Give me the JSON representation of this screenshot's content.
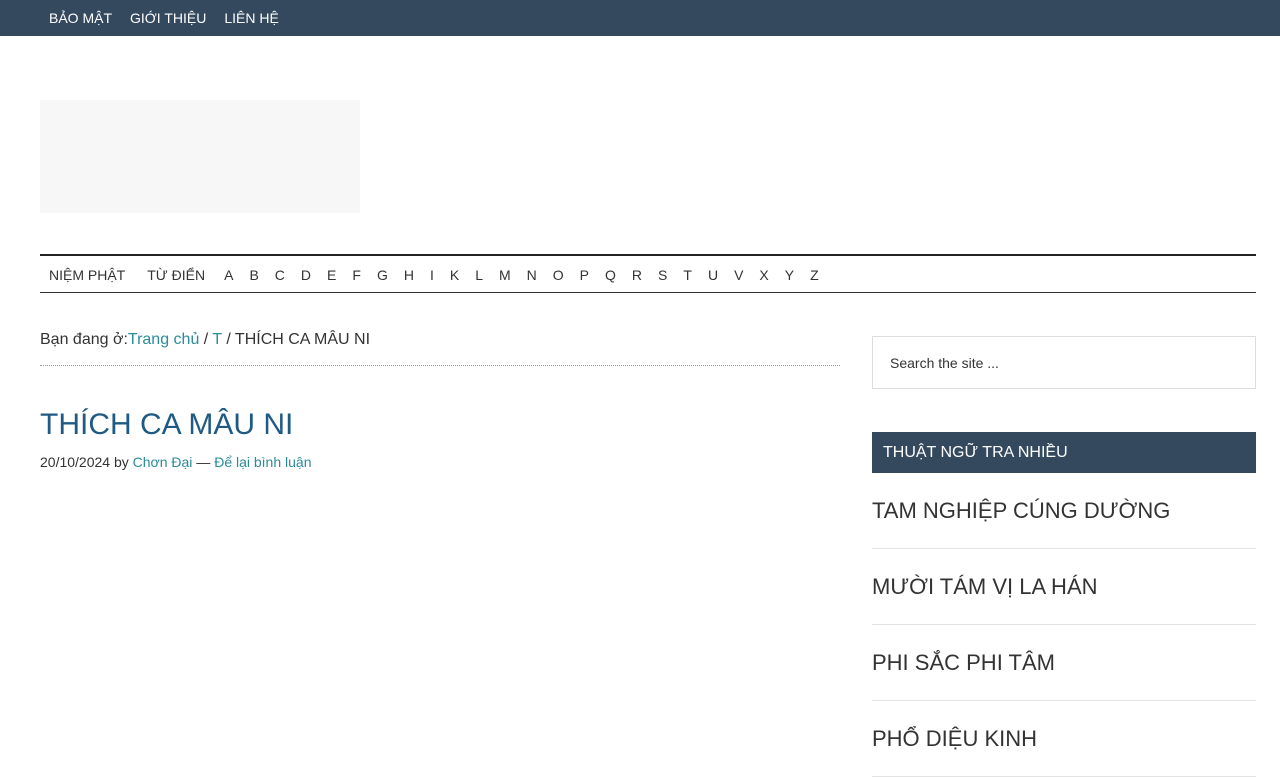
{
  "top_nav": {
    "items": [
      {
        "label": "BẢO MẬT"
      },
      {
        "label": "GIỚI THIỆU"
      },
      {
        "label": "LIÊN HỆ"
      }
    ]
  },
  "alpha_nav": {
    "items": [
      {
        "label": "NIỆM PHẬT"
      },
      {
        "label": "TỪ ĐIỂN"
      },
      {
        "label": "A"
      },
      {
        "label": "B"
      },
      {
        "label": "C"
      },
      {
        "label": "D"
      },
      {
        "label": "E"
      },
      {
        "label": "F"
      },
      {
        "label": "G"
      },
      {
        "label": "H"
      },
      {
        "label": "I"
      },
      {
        "label": "K"
      },
      {
        "label": "L"
      },
      {
        "label": "M"
      },
      {
        "label": "N"
      },
      {
        "label": "O"
      },
      {
        "label": "P"
      },
      {
        "label": "Q"
      },
      {
        "label": "R"
      },
      {
        "label": "S"
      },
      {
        "label": "T"
      },
      {
        "label": "U"
      },
      {
        "label": "V"
      },
      {
        "label": "X"
      },
      {
        "label": "Y"
      },
      {
        "label": "Z"
      }
    ]
  },
  "breadcrumb": {
    "prefix": "Bạn đang ở:",
    "home": "Trang chủ",
    "sep1": " / ",
    "category": "T",
    "sep2": " / ",
    "current": "THÍCH CA MÂU NI"
  },
  "post": {
    "title": "THÍCH CA MÂU NI",
    "date": "20/10/2024",
    "by": " by ",
    "author": "Chơn Đại",
    "dash": " — ",
    "comments_link": "Để lại bình luận"
  },
  "sidebar": {
    "search_placeholder": "Search the site ...",
    "widget_title": "THUẬT NGỮ TRA NHIỀU",
    "popular": [
      {
        "label": "TAM NGHIỆP CÚNG DƯỜNG"
      },
      {
        "label": "MƯỜI TÁM VỊ LA HÁN"
      },
      {
        "label": "PHI SẮC PHI TÂM"
      },
      {
        "label": "PHỔ DIỆU KINH"
      }
    ]
  },
  "colors": {
    "top_bar": "#34495e",
    "link": "#2a8c9a",
    "title": "#1f5a85"
  }
}
